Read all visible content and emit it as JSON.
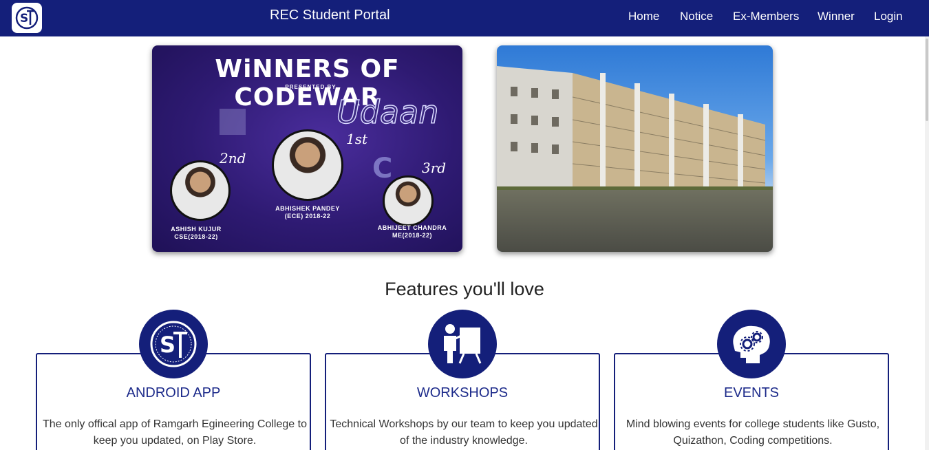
{
  "nav": {
    "brand": "REC Student Portal",
    "links": [
      "Home",
      "Notice",
      "Ex-Members",
      "Winner",
      "Login"
    ]
  },
  "carousel": {
    "poster": {
      "title": "WiNNERS OF CODEWAR",
      "presented_by": "PRESENTED BY",
      "org": "Udaan",
      "ranks": [
        "1st",
        "2nd",
        "3rd"
      ],
      "winners": [
        {
          "name": "ASHISH KUJUR",
          "detail": "CSE(2018-22)"
        },
        {
          "name": "ABHISHEK PANDEY",
          "detail": "(ECE) 2018-22"
        },
        {
          "name": "ABHIJEET CHANDRA",
          "detail": "ME(2018-22)"
        }
      ]
    }
  },
  "features": {
    "title": "Features you'll love",
    "items": [
      {
        "heading": "ANDROID APP",
        "text": "The only offical app of Ramgarh Egineering College to keep you updated, on Play Store."
      },
      {
        "heading": "WORKSHOPS",
        "text": "Technical Workshops by our team to keep you updated of the industry knowledge."
      },
      {
        "heading": "EVENTS",
        "text": "Mind blowing events for college students like Gusto, Quizathon, Coding competitions."
      }
    ]
  },
  "colors": {
    "primary": "#141f7a",
    "heading": "#1c2a8a"
  },
  "icons": [
    "sp-logo-icon",
    "teacher-board-icon",
    "brain-gears-icon"
  ]
}
